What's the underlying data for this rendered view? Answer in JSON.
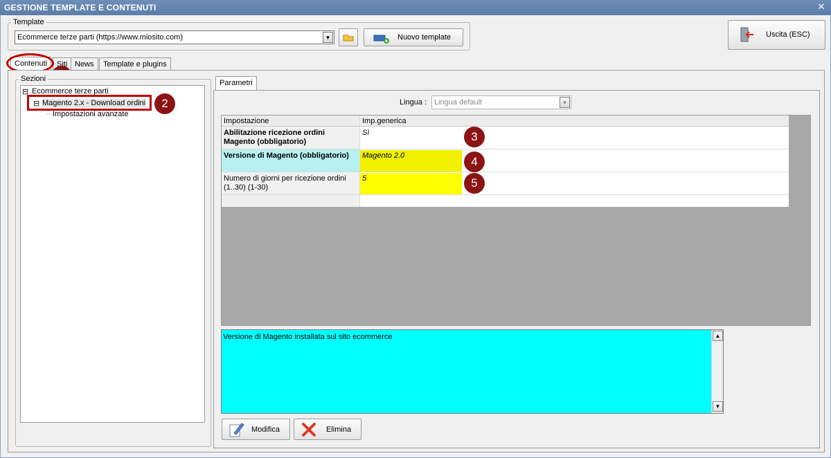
{
  "window": {
    "title": "GESTIONE TEMPLATE E CONTENUTI",
    "close_glyph": "✕"
  },
  "template_group": {
    "label": "Template",
    "selected": "Ecommerce terze parti (https://www.miosito.com)",
    "new_template_label": "Nuovo template"
  },
  "exit_button": {
    "label": "Uscita (ESC)"
  },
  "main_tabs": [
    {
      "label": "Contenuti",
      "active": true
    },
    {
      "label": "Siti"
    },
    {
      "label": "News"
    },
    {
      "label": "Template e plugins"
    }
  ],
  "sections": {
    "label": "Sezioni",
    "tree": [
      {
        "label": "Ecommerce terze parti",
        "toggle": "⊟"
      },
      {
        "label": "Magento 2.x - Download ordini",
        "toggle": "⊟",
        "selected": true
      },
      {
        "label": "Impostazioni avanzate"
      }
    ]
  },
  "params_tab": {
    "label": "Parametri"
  },
  "language": {
    "label": "Lingua :",
    "value": "Lingua default"
  },
  "grid": {
    "headers": [
      "Impostazione",
      "Imp.generica"
    ],
    "rows": [
      {
        "name": "Abilitazione ricezione ordini Magento (obbligatorio)",
        "value": "Sì",
        "bold": true
      },
      {
        "name": "Versione di Magento (obbligatorio)",
        "value": "Magento 2.0",
        "bold": true,
        "selected": true
      },
      {
        "name": "Numero di giorni per ricezione ordini (1..30) (1-30)",
        "value": "5",
        "bold": false
      }
    ]
  },
  "description": {
    "text": "Versione di Magento installata sul sito ecommerce"
  },
  "actions": {
    "edit_label": "Modifica",
    "delete_label": "Elimina"
  },
  "markers": [
    "1",
    "2",
    "3",
    "4",
    "5"
  ],
  "colors": {
    "accent": "#c00000",
    "marker": "#8b1313",
    "highlight": "#ffff00",
    "selected_row": "#b7f0f0",
    "description_bg": "#00ffff"
  },
  "icons": {
    "open_icon": "folder-icon",
    "new_icon": "add-template-icon",
    "exit_icon": "exit-door-icon",
    "edit_icon": "edit-pencil-icon",
    "delete_icon": "delete-x-icon"
  }
}
